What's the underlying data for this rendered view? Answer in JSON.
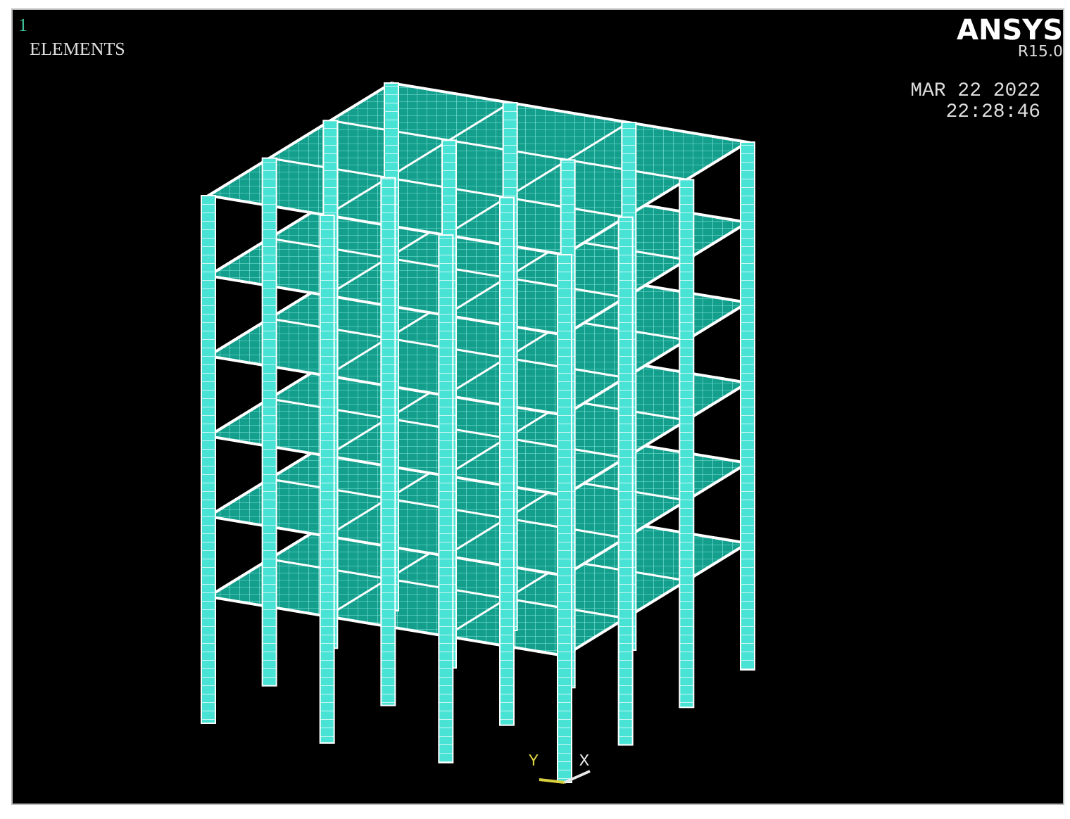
{
  "viewport": {
    "window_number": "1",
    "display_label": "ELEMENTS"
  },
  "branding": {
    "product": "ANSYS",
    "release": "R15.0"
  },
  "timestamp": {
    "date": "MAR 22 2022",
    "time": "22:28:46"
  },
  "triad": {
    "axes": [
      {
        "label": "Y",
        "color": "#d8d040"
      },
      {
        "label": "X",
        "color": "#e8e8e8"
      }
    ]
  }
}
